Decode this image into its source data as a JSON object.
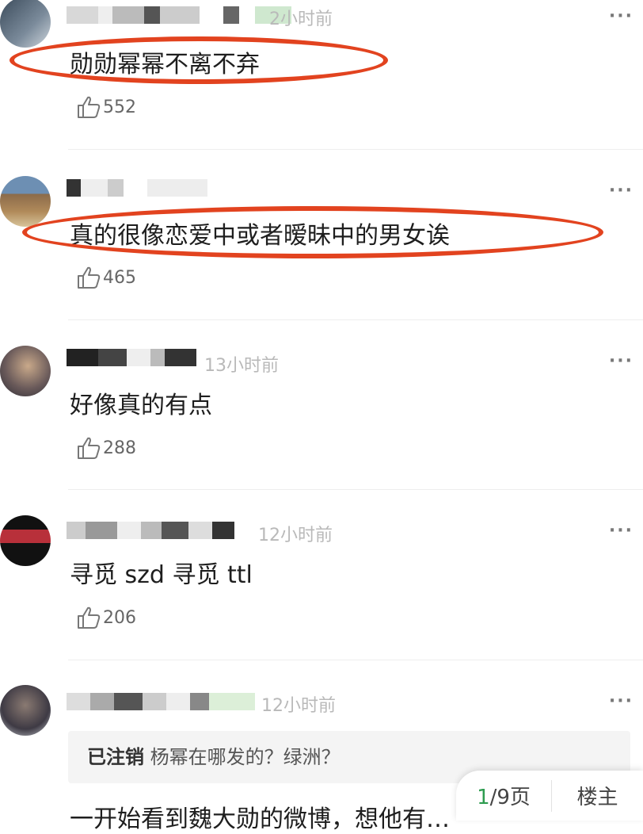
{
  "comments": [
    {
      "time": "2小时前",
      "text": "勋勋幂幂不离不弃",
      "likes": "552"
    },
    {
      "time": "",
      "text": "真的很像恋爱中或者暧昧中的男女诶",
      "likes": "465"
    },
    {
      "time": "13小时前",
      "text": "好像真的有点",
      "likes": "288"
    },
    {
      "time": "12小时前",
      "text": "寻觅 szd 寻觅 ttl",
      "likes": "206"
    },
    {
      "time": "12小时前",
      "text": "一开始看到魏大勋的微博，想他有…",
      "likes": ""
    }
  ],
  "quote": {
    "name": "已注销",
    "text": "杨幂在哪发的？绿洲？"
  },
  "more_icon": "···",
  "pager": {
    "current": "1",
    "total": "/9页",
    "op_label": "楼主"
  },
  "colors": {
    "highlight_oval": "#e2431f",
    "page_current": "#2e9c50"
  }
}
